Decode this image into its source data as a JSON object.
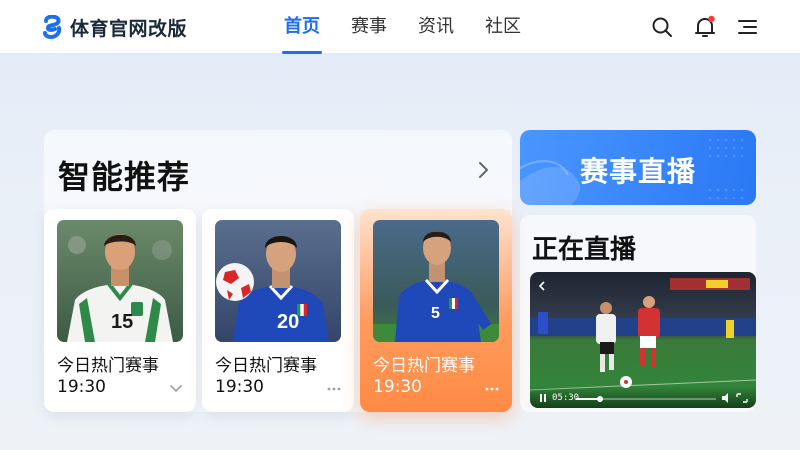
{
  "header": {
    "logo_text": "体育官网改版",
    "nav": [
      "首页",
      "赛事",
      "资讯",
      "社区"
    ],
    "active_nav": "首页",
    "icons": [
      "search-icon",
      "bell-icon",
      "menu-icon"
    ],
    "notification_dot_color": "#ff3b30"
  },
  "recommend": {
    "title": "智能推荐",
    "cards": [
      {
        "title": "今日热门赛事",
        "time": "19:30",
        "more_icon": "chevron-down-icon",
        "jersey_number": "15",
        "jersey": "white-green",
        "highlighted": false
      },
      {
        "title": "今日热门赛事",
        "time": "19:30",
        "more_icon": "more-dots-icon",
        "jersey_number": "20",
        "jersey": "blue",
        "highlighted": false
      },
      {
        "title": "今日热门赛事",
        "time": "19:30",
        "more_icon": "more-dots-icon",
        "jersey_number": "5",
        "jersey": "blue",
        "highlighted": true
      }
    ]
  },
  "live": {
    "button_label": "赛事直播",
    "section_title": "正在直播",
    "video_time": "05:30"
  },
  "colors": {
    "accent": "#1e6ef0",
    "highlight_card": "#ff8a45",
    "live_button": "#2a78f5"
  }
}
